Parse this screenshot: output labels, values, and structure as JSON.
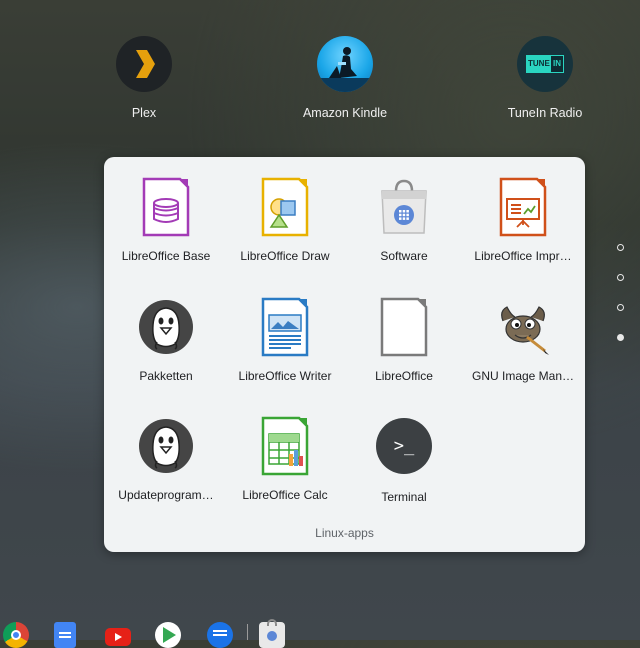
{
  "top_apps": [
    {
      "label": "Plex",
      "icon": "plex-icon"
    },
    {
      "label": "Amazon Kindle",
      "icon": "kindle-icon"
    },
    {
      "label": "TuneIn Radio",
      "icon": "tunein-icon",
      "icon_text": "TUNE IN"
    }
  ],
  "folder": {
    "name": "Linux-apps",
    "apps": [
      {
        "label": "LibreOffice Base",
        "icon": "libreoffice-base-icon"
      },
      {
        "label": "LibreOffice Draw",
        "icon": "libreoffice-draw-icon"
      },
      {
        "label": "Software",
        "icon": "software-icon"
      },
      {
        "label": "LibreOffice Impr…",
        "icon": "libreoffice-impress-icon"
      },
      {
        "label": "Pakketten",
        "icon": "pakketten-icon"
      },
      {
        "label": "LibreOffice Writer",
        "icon": "libreoffice-writer-icon"
      },
      {
        "label": "LibreOffice",
        "icon": "libreoffice-icon"
      },
      {
        "label": "GNU Image Man…",
        "icon": "gimp-icon"
      },
      {
        "label": "Updateprogram…",
        "icon": "updateprogram-icon"
      },
      {
        "label": "LibreOffice Calc",
        "icon": "libreoffice-calc-icon"
      },
      {
        "label": "Terminal",
        "icon": "terminal-icon",
        "icon_text": ">_"
      }
    ]
  },
  "pager": {
    "pages": 4,
    "active": 4
  },
  "shelf": {
    "apps": [
      "chrome-icon",
      "docs-icon",
      "youtube-icon",
      "play-store-icon",
      "messages-icon",
      "software-icon"
    ]
  }
}
